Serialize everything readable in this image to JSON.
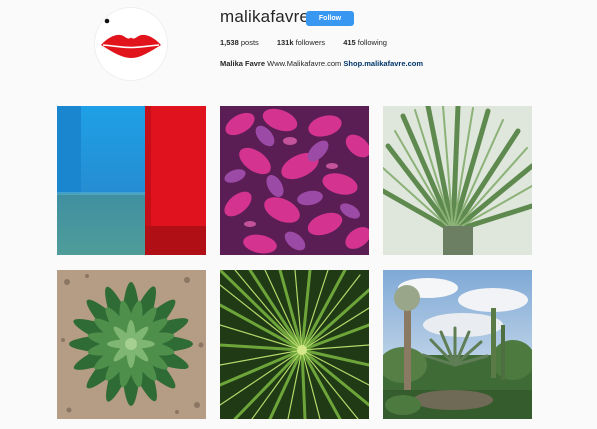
{
  "profile": {
    "username": "malikafavre",
    "follow_label": "Follow",
    "posts_count": "1,538",
    "posts_label": "posts",
    "followers_count": "131k",
    "followers_label": "followers",
    "following_count": "415",
    "following_label": "following",
    "full_name": "Malika Favre",
    "website_text": "Www.Malikafavre.com",
    "shop_link": "Shop.malikafavre.com"
  },
  "colors": {
    "follow_button": "#3897f0",
    "link": "#003569",
    "background": "#fafafa"
  },
  "posts": [
    {
      "subject": "blue and red wall corner"
    },
    {
      "subject": "pink and purple leaves"
    },
    {
      "subject": "fan palm fronds"
    },
    {
      "subject": "agave rosette"
    },
    {
      "subject": "spiky yucca center"
    },
    {
      "subject": "garden with tall yucca and cacti"
    }
  ]
}
